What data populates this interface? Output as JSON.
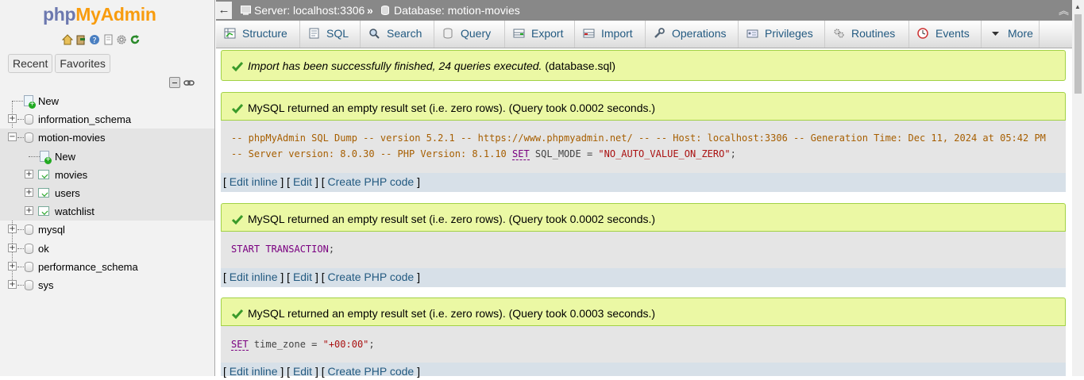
{
  "nav": {
    "logo_php": "php",
    "logo_myadmin": "MyAdmin",
    "quicklinks": [
      "home-icon",
      "logout-icon",
      "help-icon",
      "docs-icon",
      "settings-icon",
      "reload-icon"
    ],
    "tab_recent": "Recent",
    "tab_favorites": "Favorites",
    "tree": [
      {
        "label": "New",
        "type": "new",
        "level": 0
      },
      {
        "label": "information_schema",
        "type": "db",
        "level": 0
      },
      {
        "label": "motion-movies",
        "type": "db",
        "level": 0,
        "expanded": true,
        "selected": true
      },
      {
        "label": "New",
        "type": "new",
        "level": 1
      },
      {
        "label": "movies",
        "type": "table",
        "level": 1
      },
      {
        "label": "users",
        "type": "table",
        "level": 1
      },
      {
        "label": "watchlist",
        "type": "table",
        "level": 1
      },
      {
        "label": "mysql",
        "type": "db",
        "level": 0
      },
      {
        "label": "ok",
        "type": "db",
        "level": 0
      },
      {
        "label": "performance_schema",
        "type": "db",
        "level": 0
      },
      {
        "label": "sys",
        "type": "db",
        "level": 0
      }
    ]
  },
  "breadcrumb": {
    "server": "Server: localhost:3306",
    "separator": "»",
    "database": "Database: motion-movies"
  },
  "menu": {
    "structure": "Structure",
    "sql": "SQL",
    "search": "Search",
    "query": "Query",
    "export": "Export",
    "import": "Import",
    "operations": "Operations",
    "privileges": "Privileges",
    "routines": "Routines",
    "events": "Events",
    "more": "More"
  },
  "messages": {
    "import_success": "Import has been successfully finished, 24 queries executed.",
    "import_file": "(database.sql)",
    "result_1": "MySQL returned an empty result set (i.e. zero rows). (Query took 0.0002 seconds.)",
    "result_2": "MySQL returned an empty result set (i.e. zero rows). (Query took 0.0002 seconds.)",
    "result_3": "MySQL returned an empty result set (i.e. zero rows). (Query took 0.0003 seconds.)"
  },
  "sql": {
    "dump_line1": "-- phpMyAdmin SQL Dump -- version 5.2.1 -- https://www.phpmyadmin.net/ -- -- Host: localhost:3306 -- Generation Time: Dec 11, 2024 at 05:42 PM",
    "dump_line2_comment": "-- Server version: 8.0.30 -- PHP Version: 8.1.10",
    "dump_line2_kw": "SET",
    "dump_line2_rest": " SQL_MODE = ",
    "dump_line2_str": "\"NO_AUTO_VALUE_ON_ZERO\"",
    "dump_line2_end": ";",
    "start_kw": "START TRANSACTION",
    "start_end": ";",
    "tz_kw": "SET",
    "tz_rest": " time_zone = ",
    "tz_str": "\"+00:00\"",
    "tz_end": ";"
  },
  "edit": {
    "open": "[ ",
    "inline": "Edit inline",
    "sep1": " ] [ ",
    "edit": "Edit",
    "sep2": " ] [ ",
    "php": "Create PHP code",
    "close": " ]"
  }
}
